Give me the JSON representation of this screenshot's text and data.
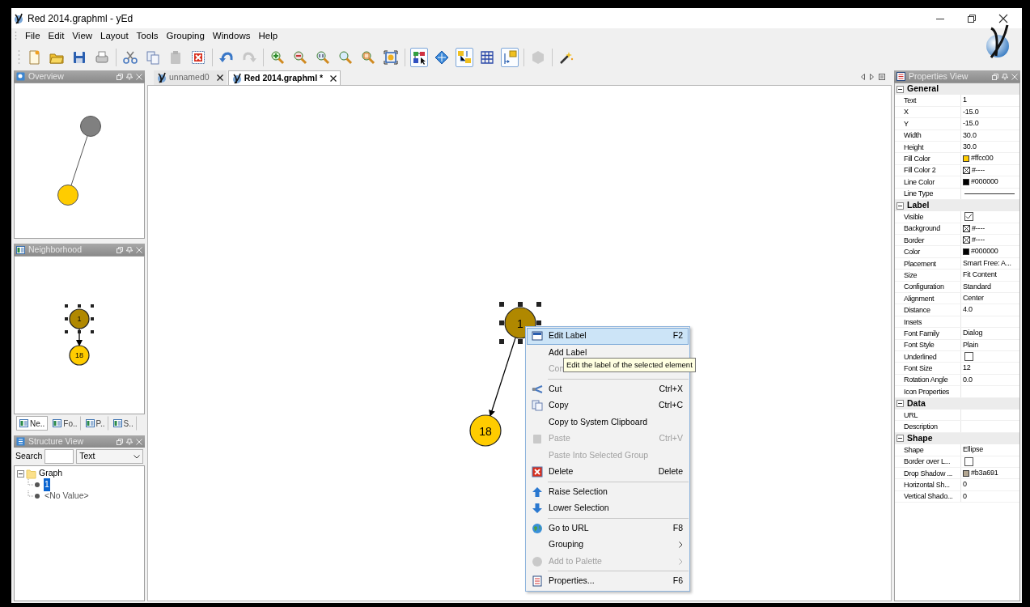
{
  "window": {
    "title": "Red 2014.graphml - yEd"
  },
  "menu_bar": [
    "File",
    "Edit",
    "View",
    "Layout",
    "Tools",
    "Grouping",
    "Windows",
    "Help"
  ],
  "toolbar": [
    {
      "kind": "button",
      "selected": false,
      "disabled": false
    },
    {
      "kind": "button",
      "selected": false,
      "disabled": false
    },
    {
      "kind": "button",
      "selected": false,
      "disabled": false
    },
    {
      "kind": "button",
      "selected": false,
      "disabled": false
    },
    {
      "kind": "separator"
    },
    {
      "kind": "button",
      "selected": false,
      "disabled": false
    },
    {
      "kind": "button",
      "selected": false,
      "disabled": false
    },
    {
      "kind": "button",
      "selected": false,
      "disabled": true
    },
    {
      "kind": "button",
      "selected": false,
      "disabled": false
    },
    {
      "kind": "separator"
    },
    {
      "kind": "button",
      "selected": false,
      "disabled": false
    },
    {
      "kind": "button",
      "selected": false,
      "disabled": true
    },
    {
      "kind": "separator"
    },
    {
      "kind": "button",
      "selected": false,
      "disabled": false
    },
    {
      "kind": "button",
      "selected": false,
      "disabled": false
    },
    {
      "kind": "button",
      "selected": false,
      "disabled": false
    },
    {
      "kind": "button",
      "selected": false,
      "disabled": false
    },
    {
      "kind": "button",
      "selected": false,
      "disabled": false
    },
    {
      "kind": "button",
      "selected": false,
      "disabled": false
    },
    {
      "kind": "separator"
    },
    {
      "kind": "button",
      "selected": true,
      "disabled": false
    },
    {
      "kind": "button",
      "selected": false,
      "disabled": false
    },
    {
      "kind": "button",
      "selected": true,
      "disabled": false
    },
    {
      "kind": "button",
      "selected": false,
      "disabled": false
    },
    {
      "kind": "button",
      "selected": true,
      "disabled": false
    },
    {
      "kind": "separator"
    },
    {
      "kind": "button",
      "selected": false,
      "disabled": true
    },
    {
      "kind": "separator"
    },
    {
      "kind": "button",
      "selected": false,
      "disabled": false
    }
  ],
  "overview": {
    "title": "Overview",
    "nodes": [
      {
        "color": "#808080"
      },
      {
        "color": "#ffcc00"
      }
    ]
  },
  "neighborhood": {
    "title": "Neighborhood",
    "nodes": [
      {
        "label": "1",
        "color": "#b08800",
        "selected": true
      },
      {
        "label": "18",
        "color": "#ffcc00",
        "selected": false
      }
    ]
  },
  "dock_tabs": [
    {
      "label": "Ne..",
      "selected": true
    },
    {
      "label": "Fo..",
      "selected": false
    },
    {
      "label": "P..",
      "selected": false
    },
    {
      "label": "S..",
      "selected": false
    }
  ],
  "structure_view": {
    "title": "Structure View",
    "search_label": "Search",
    "filter": "Text",
    "tree": [
      {
        "label": "Graph",
        "expanded": true,
        "selected": false,
        "children": [
          {
            "label": "1",
            "selected": true
          },
          {
            "label": "<No Value>",
            "selected": false
          }
        ]
      }
    ]
  },
  "document_tabs": [
    {
      "label": "unnamed0",
      "selected": false
    },
    {
      "label": "Red 2014.graphml *",
      "selected": true
    }
  ],
  "canvas": {
    "nodes": [
      {
        "label": "1",
        "color": "#b08800",
        "selected": true
      },
      {
        "label": "18",
        "color": "#ffcc00",
        "selected": false
      }
    ],
    "context_menu": [
      {
        "kind": "item",
        "label": "Edit Label",
        "shortcut": "F2",
        "selected": true,
        "disabled": false,
        "submenu": false
      },
      {
        "kind": "item",
        "label": "Add Label",
        "selected": false,
        "disabled": false,
        "submenu": false
      },
      {
        "kind": "item",
        "label": "Con",
        "selected": false,
        "disabled": true,
        "submenu": false
      },
      {
        "kind": "separator"
      },
      {
        "kind": "item",
        "label": "Cut",
        "shortcut": "Ctrl+X",
        "selected": false,
        "disabled": false,
        "submenu": false
      },
      {
        "kind": "item",
        "label": "Copy",
        "shortcut": "Ctrl+C",
        "selected": false,
        "disabled": false,
        "submenu": false
      },
      {
        "kind": "item",
        "label": "Copy to System Clipboard",
        "selected": false,
        "disabled": false,
        "submenu": false
      },
      {
        "kind": "item",
        "label": "Paste",
        "shortcut": "Ctrl+V",
        "selected": false,
        "disabled": true,
        "submenu": false
      },
      {
        "kind": "item",
        "label": "Paste Into Selected Group",
        "selected": false,
        "disabled": true,
        "submenu": false
      },
      {
        "kind": "item",
        "label": "Delete",
        "shortcut": "Delete",
        "selected": false,
        "disabled": false,
        "submenu": false
      },
      {
        "kind": "separator"
      },
      {
        "kind": "item",
        "label": "Raise Selection",
        "selected": false,
        "disabled": false,
        "submenu": false
      },
      {
        "kind": "item",
        "label": "Lower Selection",
        "selected": false,
        "disabled": false,
        "submenu": false
      },
      {
        "kind": "separator"
      },
      {
        "kind": "item",
        "label": "Go to URL",
        "shortcut": "F8",
        "selected": false,
        "disabled": false,
        "submenu": false
      },
      {
        "kind": "item",
        "label": "Grouping",
        "selected": false,
        "disabled": false,
        "submenu": true
      },
      {
        "kind": "item",
        "label": "Add to Palette",
        "selected": false,
        "disabled": true,
        "submenu": true
      },
      {
        "kind": "separator"
      },
      {
        "kind": "item",
        "label": "Properties...",
        "shortcut": "F6",
        "selected": false,
        "disabled": false,
        "submenu": false
      }
    ],
    "tooltip": "Edit the label of the selected element"
  },
  "properties": {
    "title": "Properties View",
    "sections": [
      {
        "title": "General",
        "expanded": true,
        "rows": [
          {
            "kind": "text",
            "name": "Text",
            "value": "1"
          },
          {
            "kind": "text",
            "name": "X",
            "value": "-15.0"
          },
          {
            "kind": "text",
            "name": "Y",
            "value": "-15.0"
          },
          {
            "kind": "text",
            "name": "Width",
            "value": "30.0"
          },
          {
            "kind": "text",
            "name": "Height",
            "value": "30.0"
          },
          {
            "kind": "color",
            "name": "Fill Color",
            "value": "#ffcc00",
            "color": "#ffcc00"
          },
          {
            "kind": "no-color",
            "name": "Fill Color 2",
            "value": "#----"
          },
          {
            "kind": "color",
            "name": "Line Color",
            "value": "#000000",
            "color": "#000000"
          },
          {
            "kind": "line",
            "name": "Line Type"
          }
        ]
      },
      {
        "title": "Label",
        "expanded": true,
        "rows": [
          {
            "kind": "checkbox",
            "name": "Visible",
            "checked": true
          },
          {
            "kind": "no-color",
            "name": "Background",
            "value": "#----"
          },
          {
            "kind": "no-color",
            "name": "Border",
            "value": "#----"
          },
          {
            "kind": "color",
            "name": "Color",
            "value": "#000000",
            "color": "#000000"
          },
          {
            "kind": "text",
            "name": "Placement",
            "value": "Smart Free: A..."
          },
          {
            "kind": "text",
            "name": "Size",
            "value": "Fit Content"
          },
          {
            "kind": "text",
            "name": "Configuration",
            "value": "Standard"
          },
          {
            "kind": "text",
            "name": "Alignment",
            "value": "Center"
          },
          {
            "kind": "text",
            "name": "Distance",
            "value": "4.0"
          },
          {
            "kind": "text",
            "name": "Insets"
          },
          {
            "kind": "text",
            "name": "Font Family",
            "value": "Dialog"
          },
          {
            "kind": "text",
            "name": "Font Style",
            "value": "Plain"
          },
          {
            "kind": "checkbox",
            "name": "Underlined",
            "checked": false
          },
          {
            "kind": "text",
            "name": "Font Size",
            "value": "12"
          },
          {
            "kind": "text",
            "name": "Rotation Angle",
            "value": "0.0"
          },
          {
            "kind": "text",
            "name": "Icon Properties"
          }
        ]
      },
      {
        "title": "Data",
        "expanded": true,
        "rows": [
          {
            "kind": "text",
            "name": "URL"
          },
          {
            "kind": "text",
            "name": "Description"
          }
        ]
      },
      {
        "title": "Shape",
        "expanded": true,
        "rows": [
          {
            "kind": "text",
            "name": "Shape",
            "value": "Ellipse"
          },
          {
            "kind": "checkbox",
            "name": "Border over L...",
            "checked": false
          },
          {
            "kind": "color",
            "name": "Drop Shadow ...",
            "value": "#b3a691",
            "color": "#b3a691"
          },
          {
            "kind": "text",
            "name": "Horizontal Sh...",
            "value": "0"
          },
          {
            "kind": "text",
            "name": "Vertical Shado...",
            "value": "0"
          }
        ]
      }
    ]
  }
}
